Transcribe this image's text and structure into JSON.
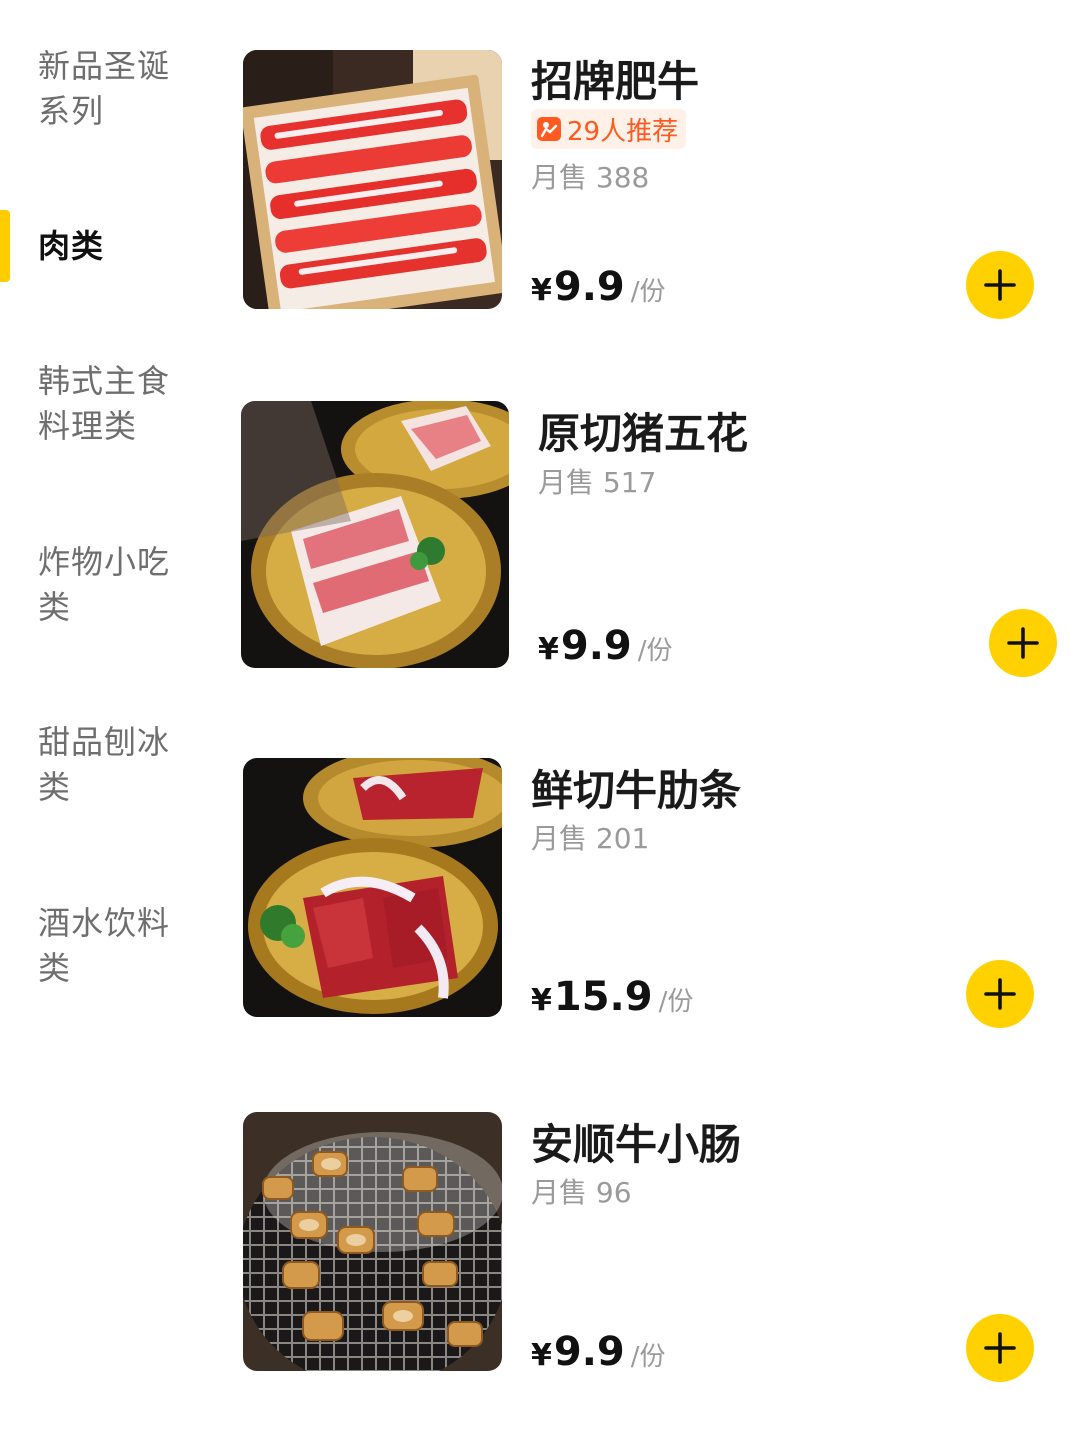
{
  "sidebar": {
    "categories": [
      {
        "line1": "新品圣诞",
        "line2": "系列"
      },
      {
        "line1": "肉类",
        "line2": ""
      },
      {
        "line1": "韩式主食",
        "line2": "料理类"
      },
      {
        "line1": "炸物小吃",
        "line2": "类"
      },
      {
        "line1": "甜品刨冰",
        "line2": "类"
      },
      {
        "line1": "酒水饮料",
        "line2": "类"
      }
    ],
    "active_index": 1,
    "active_color": "#ffcc00"
  },
  "products": [
    {
      "name": "招牌肥牛",
      "badge": "29人推荐",
      "sales": "月售 388",
      "currency": "¥",
      "price": "9.9",
      "unit": "/份",
      "image_icon": "beef-slices-tray"
    },
    {
      "name": "原切猪五花",
      "badge": "",
      "sales": "月售 517",
      "currency": "¥",
      "price": "9.9",
      "unit": "/份",
      "image_icon": "pork-belly-plate"
    },
    {
      "name": "鲜切牛肋条",
      "badge": "",
      "sales": "月售 201",
      "currency": "¥",
      "price": "15.9",
      "unit": "/份",
      "image_icon": "beef-rib-strips-plate"
    },
    {
      "name": "安顺牛小肠",
      "badge": "",
      "sales": "月售 96",
      "currency": "¥",
      "price": "9.9",
      "unit": "/份",
      "image_icon": "grilled-intestine"
    }
  ],
  "colors": {
    "accent": "#ffd100",
    "badge_text": "#ff5a1f",
    "badge_bg": "#fff1e8",
    "muted_text": "#9a9a9a"
  },
  "icons": {
    "add": "plus-icon",
    "recommend": "thumbs-up-icon"
  }
}
